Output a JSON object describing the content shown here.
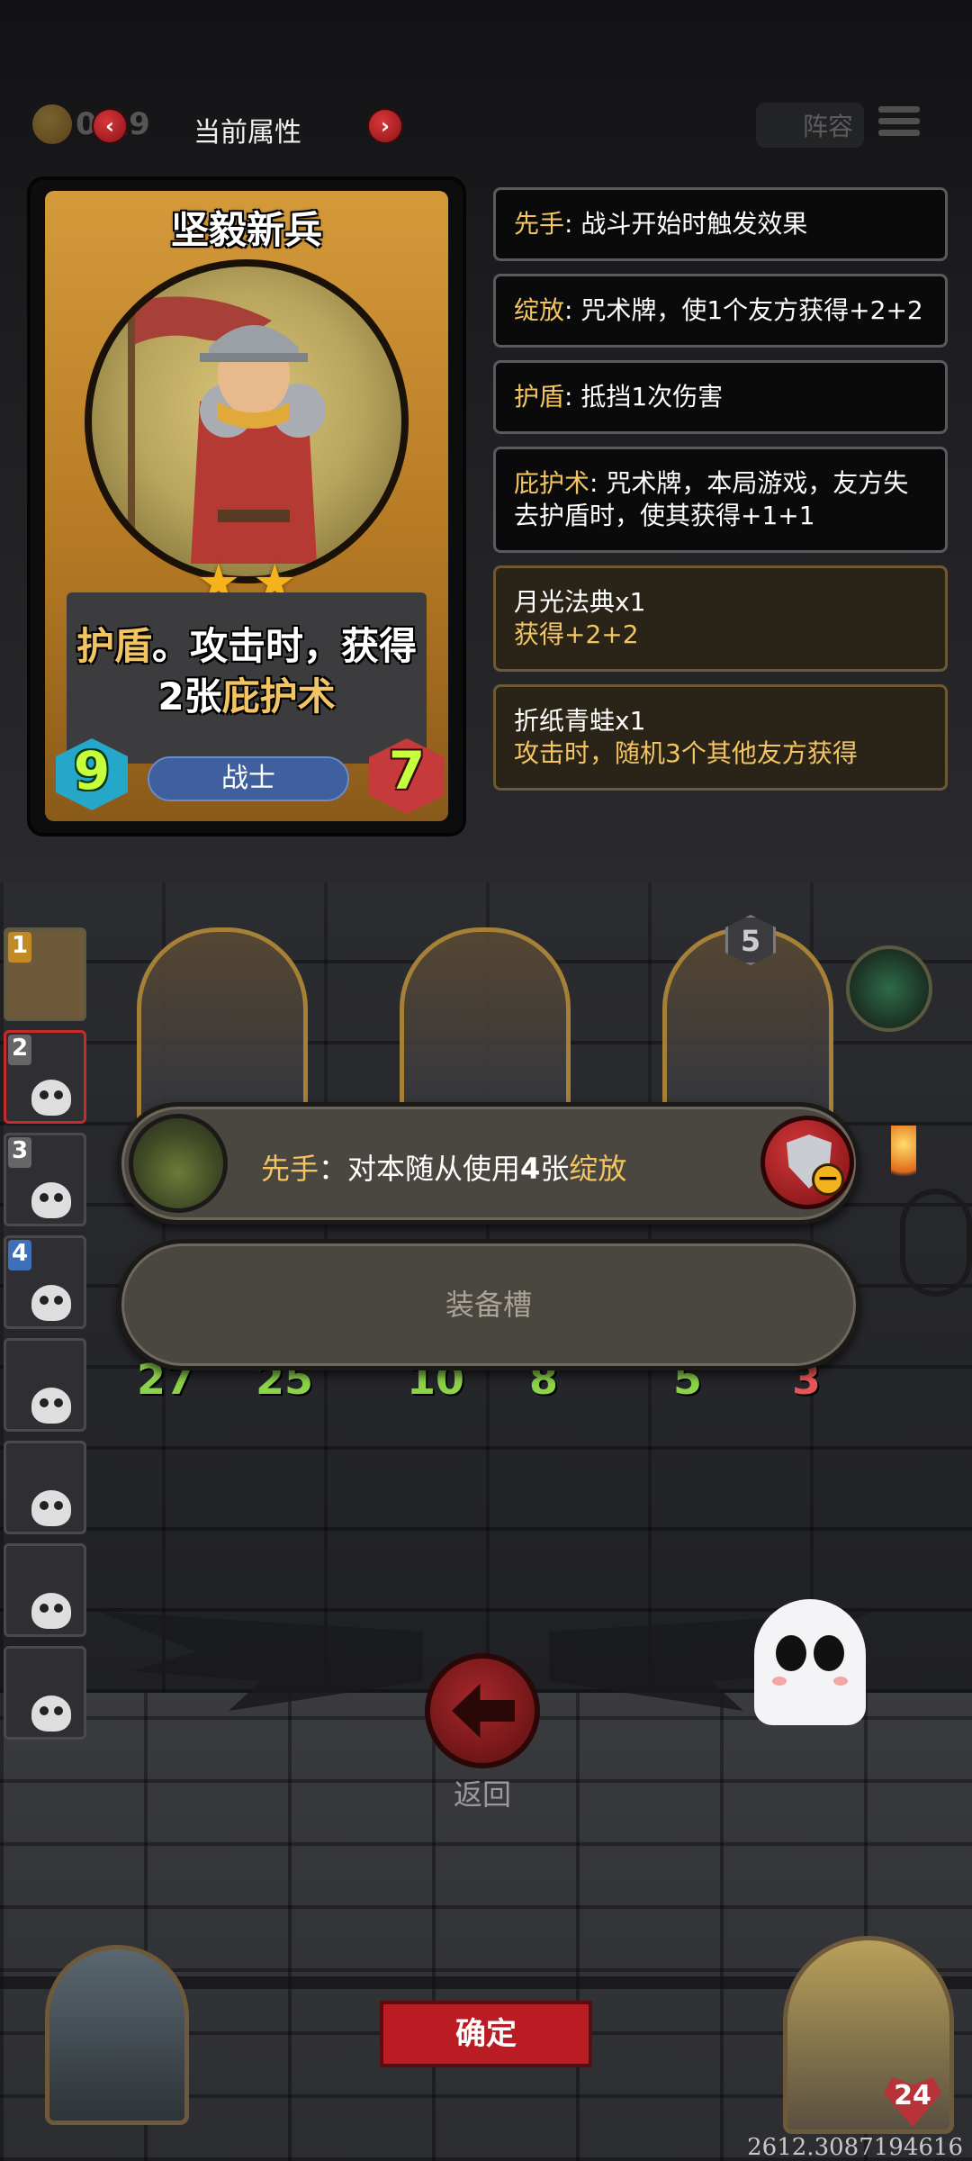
{
  "top_bar": {
    "coin_count": "0 19",
    "title": "当前属性",
    "lineup_label": "阵容"
  },
  "card": {
    "name": "坚毅新兵",
    "stars": 2,
    "ability_line1_kw": "护盾",
    "ability_line1_rest": "。攻击时，获得",
    "ability_line2_num": "2张",
    "ability_line2_kw": "庇护术",
    "attack": "9",
    "class": "战士",
    "health": "7",
    "colors": {
      "frame": "#d49a3a",
      "keyword": "#f3c562"
    }
  },
  "descriptions": [
    {
      "key": "先手",
      "sep": ": ",
      "text": "战斗开始时触发效果",
      "style": "dark"
    },
    {
      "key": "绽放",
      "sep": ": ",
      "text": "咒术牌，使1个友方获得+2+2",
      "style": "dark"
    },
    {
      "key": "护盾",
      "sep": ": ",
      "text": "抵挡1次伤害",
      "style": "dark"
    },
    {
      "key": "庇护术",
      "sep": ": ",
      "text": "咒术牌，本局游戏，友方失去护盾时，使其获得+1+1",
      "style": "dark"
    },
    {
      "title": "月光法典x1",
      "text": "获得+2+2",
      "style": "gold"
    },
    {
      "title": "折纸青蛙x1",
      "text": "攻击时，随机3个其他友方获得",
      "style": "gold"
    }
  ],
  "side_list": [
    {
      "number": "1",
      "badge": "gold"
    },
    {
      "number": "2",
      "badge": "grey"
    },
    {
      "number": "3",
      "badge": "grey"
    },
    {
      "number": "4",
      "badge": "blue"
    },
    {
      "number": "",
      "badge": ""
    },
    {
      "number": "",
      "badge": ""
    },
    {
      "number": "",
      "badge": ""
    },
    {
      "number": "",
      "badge": ""
    }
  ],
  "board": {
    "minions": [
      {
        "attack": "27",
        "health": "25"
      },
      {
        "attack": "10",
        "health": "8"
      },
      {
        "attack": "5",
        "health": "3"
      }
    ],
    "tier": "5"
  },
  "popup": {
    "effect_key": "先手",
    "effect_colon": "：",
    "effect_text_a": "对本随从使用",
    "effect_num": "4",
    "effect_text_b": "张",
    "effect_kw": "绽放",
    "slot_label": "装备槽"
  },
  "back_label": "返回",
  "confirm_label": "确定",
  "player_health": "24",
  "coordinates": "2612.3087194616"
}
